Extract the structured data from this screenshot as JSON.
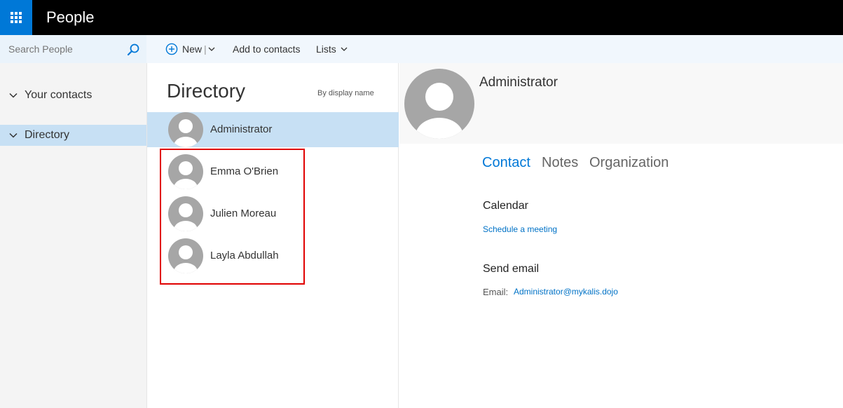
{
  "app": {
    "title": "People"
  },
  "search": {
    "placeholder": "Search People"
  },
  "nav": {
    "your_contacts": "Your contacts",
    "directory": "Directory"
  },
  "toolbar": {
    "new_label": "New",
    "separator": "|",
    "add_to_contacts": "Add to contacts",
    "lists": "Lists"
  },
  "list": {
    "title": "Directory",
    "sort_label": "By display name",
    "contacts": [
      {
        "name": "Administrator"
      },
      {
        "name": "Emma O'Brien"
      },
      {
        "name": "Julien Moreau"
      },
      {
        "name": "Layla Abdullah"
      }
    ]
  },
  "detail": {
    "name": "Administrator",
    "tabs": [
      "Contact",
      "Notes",
      "Organization"
    ],
    "calendar": {
      "title": "Calendar",
      "action": "Schedule a meeting"
    },
    "email": {
      "title": "Send email",
      "label": "Email:",
      "address": "Administrator@mykalis.dojo"
    }
  },
  "colors": {
    "accent": "#0078d7",
    "selection": "#c7e0f4",
    "highlight_box": "#e00000"
  }
}
